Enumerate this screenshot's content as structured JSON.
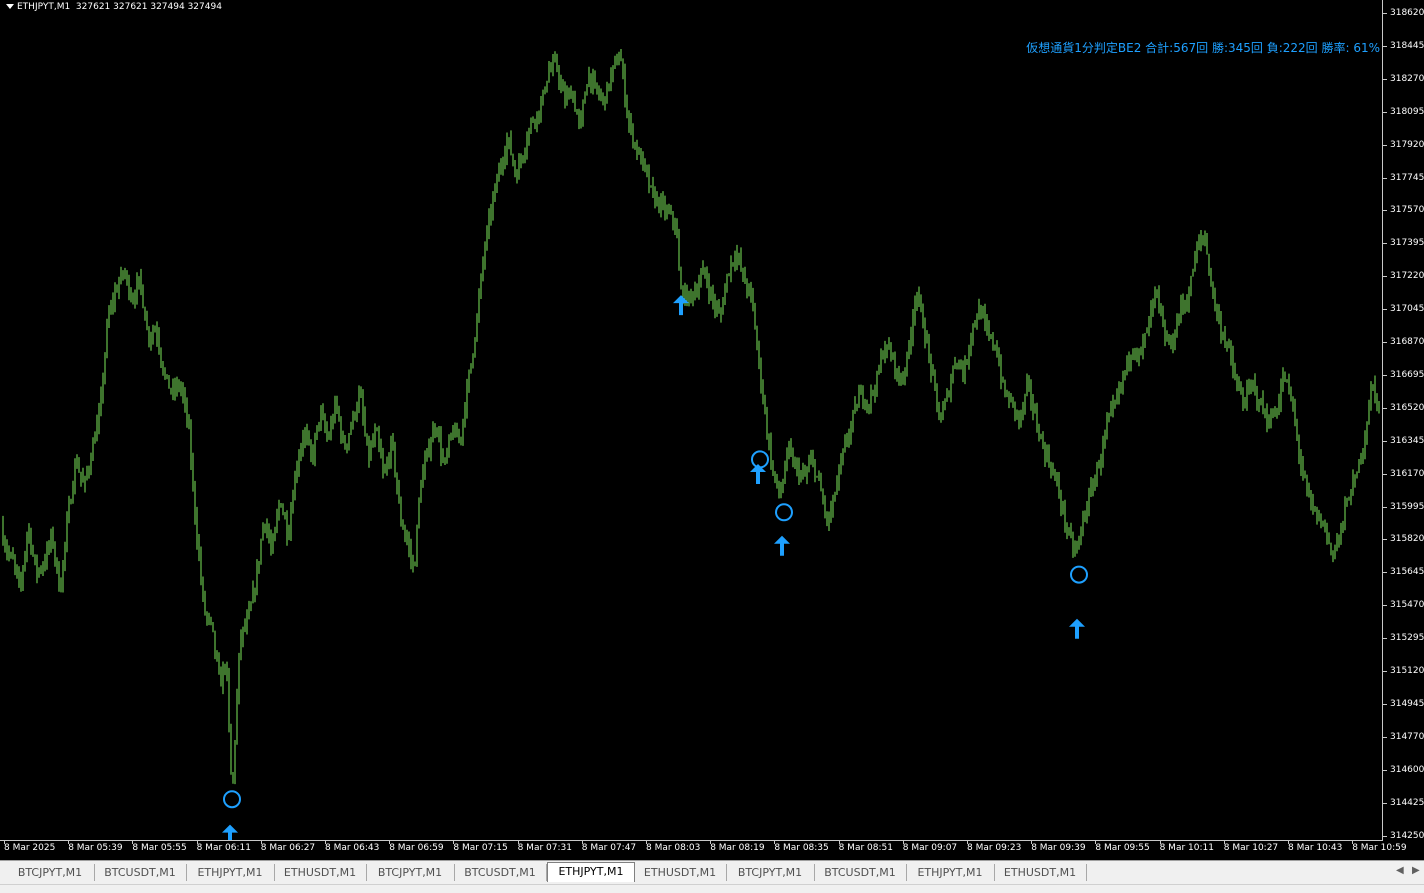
{
  "header": {
    "symbol": "ETHJPYT,M1",
    "ohlc": "327621 327621 327494 327494"
  },
  "stats_text": "仮想通貨1分判定BE2  合計:567回  勝:345回 負:222回 勝率: 61%",
  "colors": {
    "background": "#000000",
    "candle": "#7CE85A",
    "signal": "#1EA0FF",
    "axis_text": "#FFFFFF"
  },
  "price_axis": {
    "labels": [
      "318620",
      "318445",
      "318270",
      "318095",
      "317920",
      "317745",
      "317570",
      "317395",
      "317220",
      "317045",
      "316870",
      "316695",
      "316520",
      "316345",
      "316170",
      "315995",
      "315820",
      "315645",
      "315470",
      "315295",
      "315120",
      "314945",
      "314770",
      "314600",
      "314425",
      "314250"
    ]
  },
  "time_axis": {
    "labels": [
      "8 Mar 2025",
      "8 Mar 05:39",
      "8 Mar 05:55",
      "8 Mar 06:11",
      "8 Mar 06:27",
      "8 Mar 06:43",
      "8 Mar 06:59",
      "8 Mar 07:15",
      "8 Mar 07:31",
      "8 Mar 07:47",
      "8 Mar 08:03",
      "8 Mar 08:19",
      "8 Mar 08:35",
      "8 Mar 08:51",
      "8 Mar 09:07",
      "8 Mar 09:23",
      "8 Mar 09:39",
      "8 Mar 09:55",
      "8 Mar 10:11",
      "8 Mar 10:27",
      "8 Mar 10:43",
      "8 Mar 10:59"
    ]
  },
  "tabs": [
    {
      "label": "BTCJPYT,M1",
      "active": false
    },
    {
      "label": "BTCUSDT,M1",
      "active": false
    },
    {
      "label": "ETHJPYT,M1",
      "active": false
    },
    {
      "label": "ETHUSDT,M1",
      "active": false
    },
    {
      "label": "BTCJPYT,M1",
      "active": false
    },
    {
      "label": "BTCUSDT,M1",
      "active": false
    },
    {
      "label": "ETHJPYT,M1",
      "active": true
    },
    {
      "label": "ETHUSDT,M1",
      "active": false
    },
    {
      "label": "BTCJPYT,M1",
      "active": false
    },
    {
      "label": "BTCUSDT,M1",
      "active": false
    },
    {
      "label": "ETHJPYT,M1",
      "active": false
    },
    {
      "label": "ETHUSDT,M1",
      "active": false
    }
  ],
  "chart_data": {
    "type": "bar",
    "symbol": "ETHJPYT",
    "timeframe": "M1",
    "ylim": [
      314250,
      318700
    ],
    "price_path": [
      [
        0,
        315900
      ],
      [
        8,
        315750
      ],
      [
        14,
        315700
      ],
      [
        20,
        315550
      ],
      [
        28,
        315900
      ],
      [
        36,
        315650
      ],
      [
        44,
        315700
      ],
      [
        52,
        315850
      ],
      [
        60,
        315550
      ],
      [
        68,
        315950
      ],
      [
        76,
        316250
      ],
      [
        84,
        316100
      ],
      [
        92,
        316300
      ],
      [
        100,
        316500
      ],
      [
        108,
        317000
      ],
      [
        116,
        317150
      ],
      [
        124,
        317250
      ],
      [
        132,
        317100
      ],
      [
        140,
        317200
      ],
      [
        148,
        316900
      ],
      [
        156,
        316950
      ],
      [
        164,
        316700
      ],
      [
        172,
        316600
      ],
      [
        180,
        316650
      ],
      [
        188,
        316450
      ],
      [
        196,
        315900
      ],
      [
        204,
        315450
      ],
      [
        212,
        315350
      ],
      [
        220,
        315050
      ],
      [
        226,
        315200
      ],
      [
        232,
        314450
      ],
      [
        240,
        315300
      ],
      [
        248,
        315400
      ],
      [
        256,
        315600
      ],
      [
        264,
        315950
      ],
      [
        272,
        315750
      ],
      [
        280,
        316050
      ],
      [
        288,
        315850
      ],
      [
        296,
        316200
      ],
      [
        304,
        316400
      ],
      [
        312,
        316250
      ],
      [
        320,
        316500
      ],
      [
        328,
        316350
      ],
      [
        336,
        316550
      ],
      [
        344,
        316300
      ],
      [
        352,
        316450
      ],
      [
        360,
        316600
      ],
      [
        368,
        316250
      ],
      [
        376,
        316400
      ],
      [
        384,
        316150
      ],
      [
        392,
        316350
      ],
      [
        400,
        315950
      ],
      [
        408,
        315800
      ],
      [
        414,
        315650
      ],
      [
        420,
        316100
      ],
      [
        428,
        316300
      ],
      [
        436,
        316450
      ],
      [
        444,
        316200
      ],
      [
        452,
        316400
      ],
      [
        460,
        316350
      ],
      [
        468,
        316650
      ],
      [
        476,
        316950
      ],
      [
        484,
        317350
      ],
      [
        492,
        317600
      ],
      [
        500,
        317800
      ],
      [
        508,
        317950
      ],
      [
        516,
        317750
      ],
      [
        524,
        317900
      ],
      [
        532,
        318050
      ],
      [
        540,
        318100
      ],
      [
        548,
        318300
      ],
      [
        556,
        318350
      ],
      [
        564,
        318150
      ],
      [
        572,
        318200
      ],
      [
        580,
        318000
      ],
      [
        588,
        318300
      ],
      [
        596,
        318200
      ],
      [
        604,
        318150
      ],
      [
        612,
        318300
      ],
      [
        620,
        318400
      ],
      [
        628,
        318050
      ],
      [
        636,
        317900
      ],
      [
        644,
        317800
      ],
      [
        652,
        317650
      ],
      [
        660,
        317600
      ],
      [
        668,
        317550
      ],
      [
        676,
        317500
      ],
      [
        680,
        317150
      ],
      [
        688,
        317100
      ],
      [
        696,
        317150
      ],
      [
        704,
        317250
      ],
      [
        712,
        317100
      ],
      [
        720,
        317000
      ],
      [
        728,
        317250
      ],
      [
        736,
        317350
      ],
      [
        744,
        317200
      ],
      [
        752,
        317100
      ],
      [
        758,
        316800
      ],
      [
        766,
        316450
      ],
      [
        772,
        316200
      ],
      [
        780,
        316050
      ],
      [
        788,
        316300
      ],
      [
        796,
        316200
      ],
      [
        804,
        316150
      ],
      [
        812,
        316250
      ],
      [
        820,
        316100
      ],
      [
        828,
        315900
      ],
      [
        836,
        316100
      ],
      [
        844,
        316300
      ],
      [
        852,
        316450
      ],
      [
        860,
        316600
      ],
      [
        868,
        316550
      ],
      [
        876,
        316650
      ],
      [
        884,
        316850
      ],
      [
        892,
        316800
      ],
      [
        900,
        316650
      ],
      [
        908,
        316800
      ],
      [
        916,
        317150
      ],
      [
        924,
        316950
      ],
      [
        932,
        316700
      ],
      [
        940,
        316450
      ],
      [
        948,
        316600
      ],
      [
        956,
        316800
      ],
      [
        964,
        316700
      ],
      [
        972,
        316950
      ],
      [
        980,
        317050
      ],
      [
        988,
        316900
      ],
      [
        996,
        316850
      ],
      [
        1004,
        316600
      ],
      [
        1012,
        316550
      ],
      [
        1020,
        316450
      ],
      [
        1028,
        316650
      ],
      [
        1036,
        316450
      ],
      [
        1044,
        316300
      ],
      [
        1052,
        316200
      ],
      [
        1060,
        316050
      ],
      [
        1068,
        315850
      ],
      [
        1076,
        315750
      ],
      [
        1084,
        315950
      ],
      [
        1092,
        316100
      ],
      [
        1100,
        316250
      ],
      [
        1108,
        316450
      ],
      [
        1116,
        316550
      ],
      [
        1124,
        316700
      ],
      [
        1132,
        316850
      ],
      [
        1140,
        316800
      ],
      [
        1148,
        316950
      ],
      [
        1156,
        317150
      ],
      [
        1164,
        316900
      ],
      [
        1172,
        316850
      ],
      [
        1180,
        317050
      ],
      [
        1188,
        317100
      ],
      [
        1196,
        317350
      ],
      [
        1204,
        317450
      ],
      [
        1212,
        317150
      ],
      [
        1220,
        316950
      ],
      [
        1228,
        316850
      ],
      [
        1236,
        316650
      ],
      [
        1244,
        316550
      ],
      [
        1252,
        316650
      ],
      [
        1260,
        316550
      ],
      [
        1268,
        316450
      ],
      [
        1276,
        316500
      ],
      [
        1284,
        316700
      ],
      [
        1292,
        316550
      ],
      [
        1300,
        316250
      ],
      [
        1308,
        316050
      ],
      [
        1316,
        315950
      ],
      [
        1324,
        315900
      ],
      [
        1332,
        315750
      ],
      [
        1340,
        315850
      ],
      [
        1348,
        316050
      ],
      [
        1356,
        316150
      ],
      [
        1364,
        316350
      ],
      [
        1372,
        316650
      ],
      [
        1380,
        316500
      ]
    ],
    "buy_signals": [
      {
        "time": "8 Mar 06:11",
        "price": 314390,
        "circle_price": 314450
      },
      {
        "time": "8 Mar 08:03",
        "price": 317120,
        "circle_price": null
      },
      {
        "time": "8 Mar 08:19",
        "price": 316300,
        "circle_price": 316250
      },
      {
        "time": "8 Mar 08:35",
        "price": 315920,
        "circle_price": 315970
      },
      {
        "time": "8 Mar 09:39",
        "price": 315480,
        "circle_price": 315640
      }
    ]
  }
}
